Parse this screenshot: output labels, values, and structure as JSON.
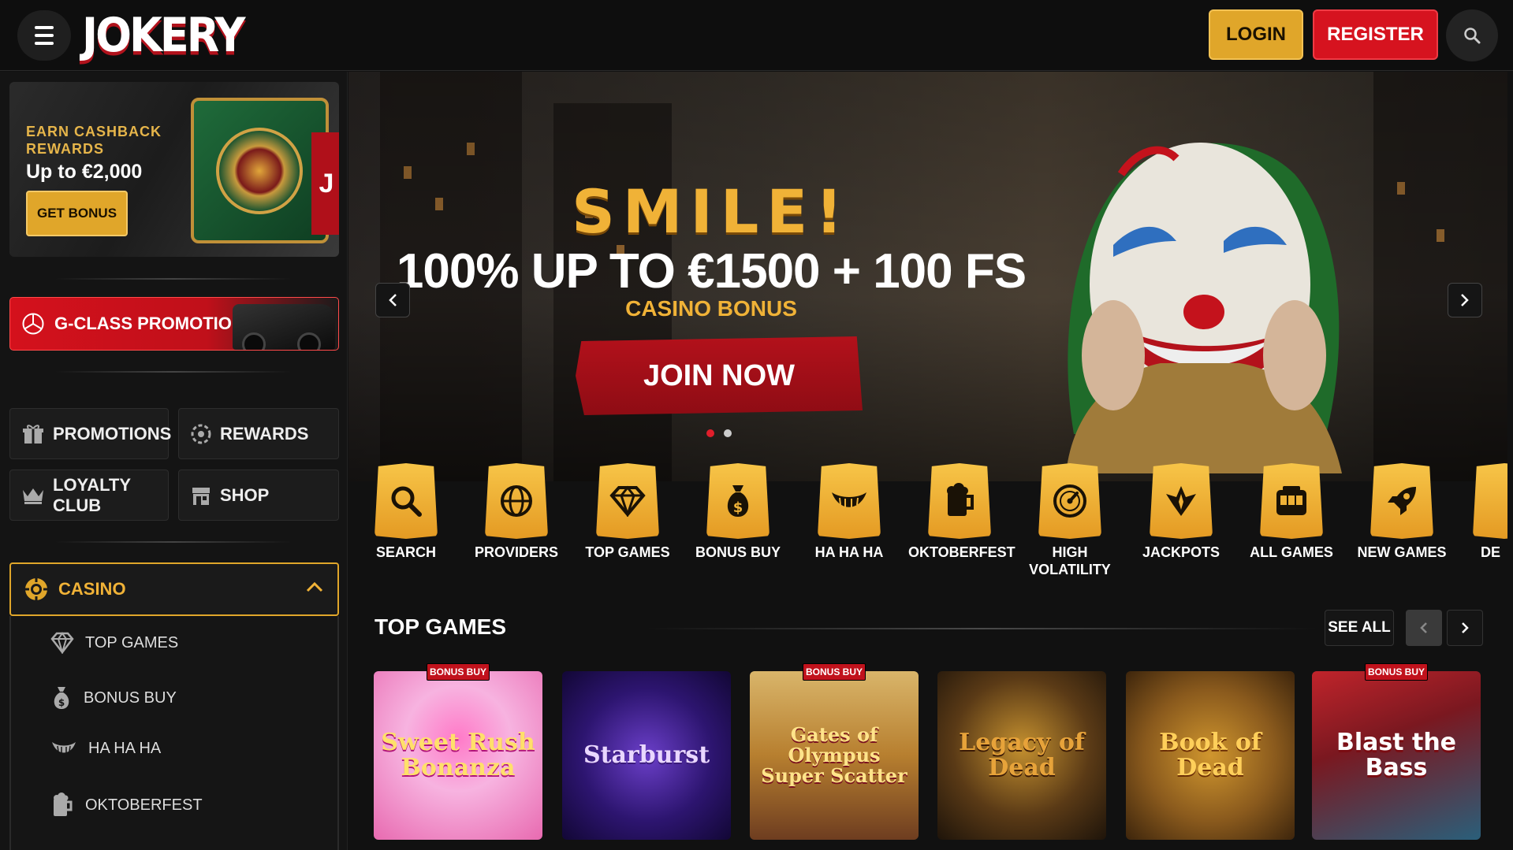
{
  "header": {
    "logo": "JOKERY",
    "login_label": "LOGIN",
    "register_label": "REGISTER"
  },
  "sidebar": {
    "cashback": {
      "title": "EARN CASHBACK REWARDS",
      "amount": "Up to €2,000",
      "button": "GET BONUS"
    },
    "gclass": "G-CLASS PROMOTION",
    "nav": [
      {
        "label": "PROMOTIONS",
        "icon": "gift-icon"
      },
      {
        "label": "REWARDS",
        "icon": "rewards-icon"
      },
      {
        "label": "LOYALTY CLUB",
        "icon": "crown-icon"
      },
      {
        "label": "SHOP",
        "icon": "shop-icon"
      }
    ],
    "casino": {
      "label": "CASINO",
      "items": [
        {
          "label": "TOP GAMES",
          "icon": "diamond-icon"
        },
        {
          "label": "BONUS BUY",
          "icon": "money-bag-icon"
        },
        {
          "label": "HA HA HA",
          "icon": "grin-icon"
        },
        {
          "label": "OKTOBERFEST",
          "icon": "beer-icon"
        }
      ]
    }
  },
  "hero": {
    "headline": "SMILE!",
    "offer": "100% UP TO €1500 + 100 FS",
    "subtitle": "CASINO BONUS",
    "cta": "JOIN NOW",
    "slides": 2,
    "active_slide": 1
  },
  "categories": [
    {
      "label": "SEARCH",
      "icon": "search-icon"
    },
    {
      "label": "PROVIDERS",
      "icon": "globe-icon"
    },
    {
      "label": "TOP GAMES",
      "icon": "diamond-icon"
    },
    {
      "label": "BONUS BUY",
      "icon": "money-bag-icon"
    },
    {
      "label": "HA HA HA",
      "icon": "grin-icon"
    },
    {
      "label": "OKTOBERFEST",
      "icon": "beer-icon"
    },
    {
      "label": "HIGH VOLATILITY",
      "icon": "gauge-icon"
    },
    {
      "label": "JACKPOTS",
      "icon": "jackpot-icon"
    },
    {
      "label": "ALL GAMES",
      "icon": "slot-machine-icon"
    },
    {
      "label": "NEW GAMES",
      "icon": "rocket-icon"
    },
    {
      "label": "DE",
      "icon": "partial-icon"
    }
  ],
  "top_games": {
    "title": "TOP GAMES",
    "see_all": "SEE ALL",
    "badge_label": "BONUS BUY",
    "games": [
      {
        "name": "Sweet Rush Bonanza",
        "bonus_buy": true
      },
      {
        "name": "Starburst",
        "bonus_buy": false
      },
      {
        "name": "Gates of Olympus Super Scatter",
        "bonus_buy": true
      },
      {
        "name": "Legacy of Dead",
        "bonus_buy": false
      },
      {
        "name": "Book of Dead",
        "bonus_buy": false
      },
      {
        "name": "Blast the Bass",
        "bonus_buy": true
      }
    ]
  },
  "colors": {
    "gold": "#e0a62a",
    "red": "#d6131f",
    "background": "#111111"
  }
}
